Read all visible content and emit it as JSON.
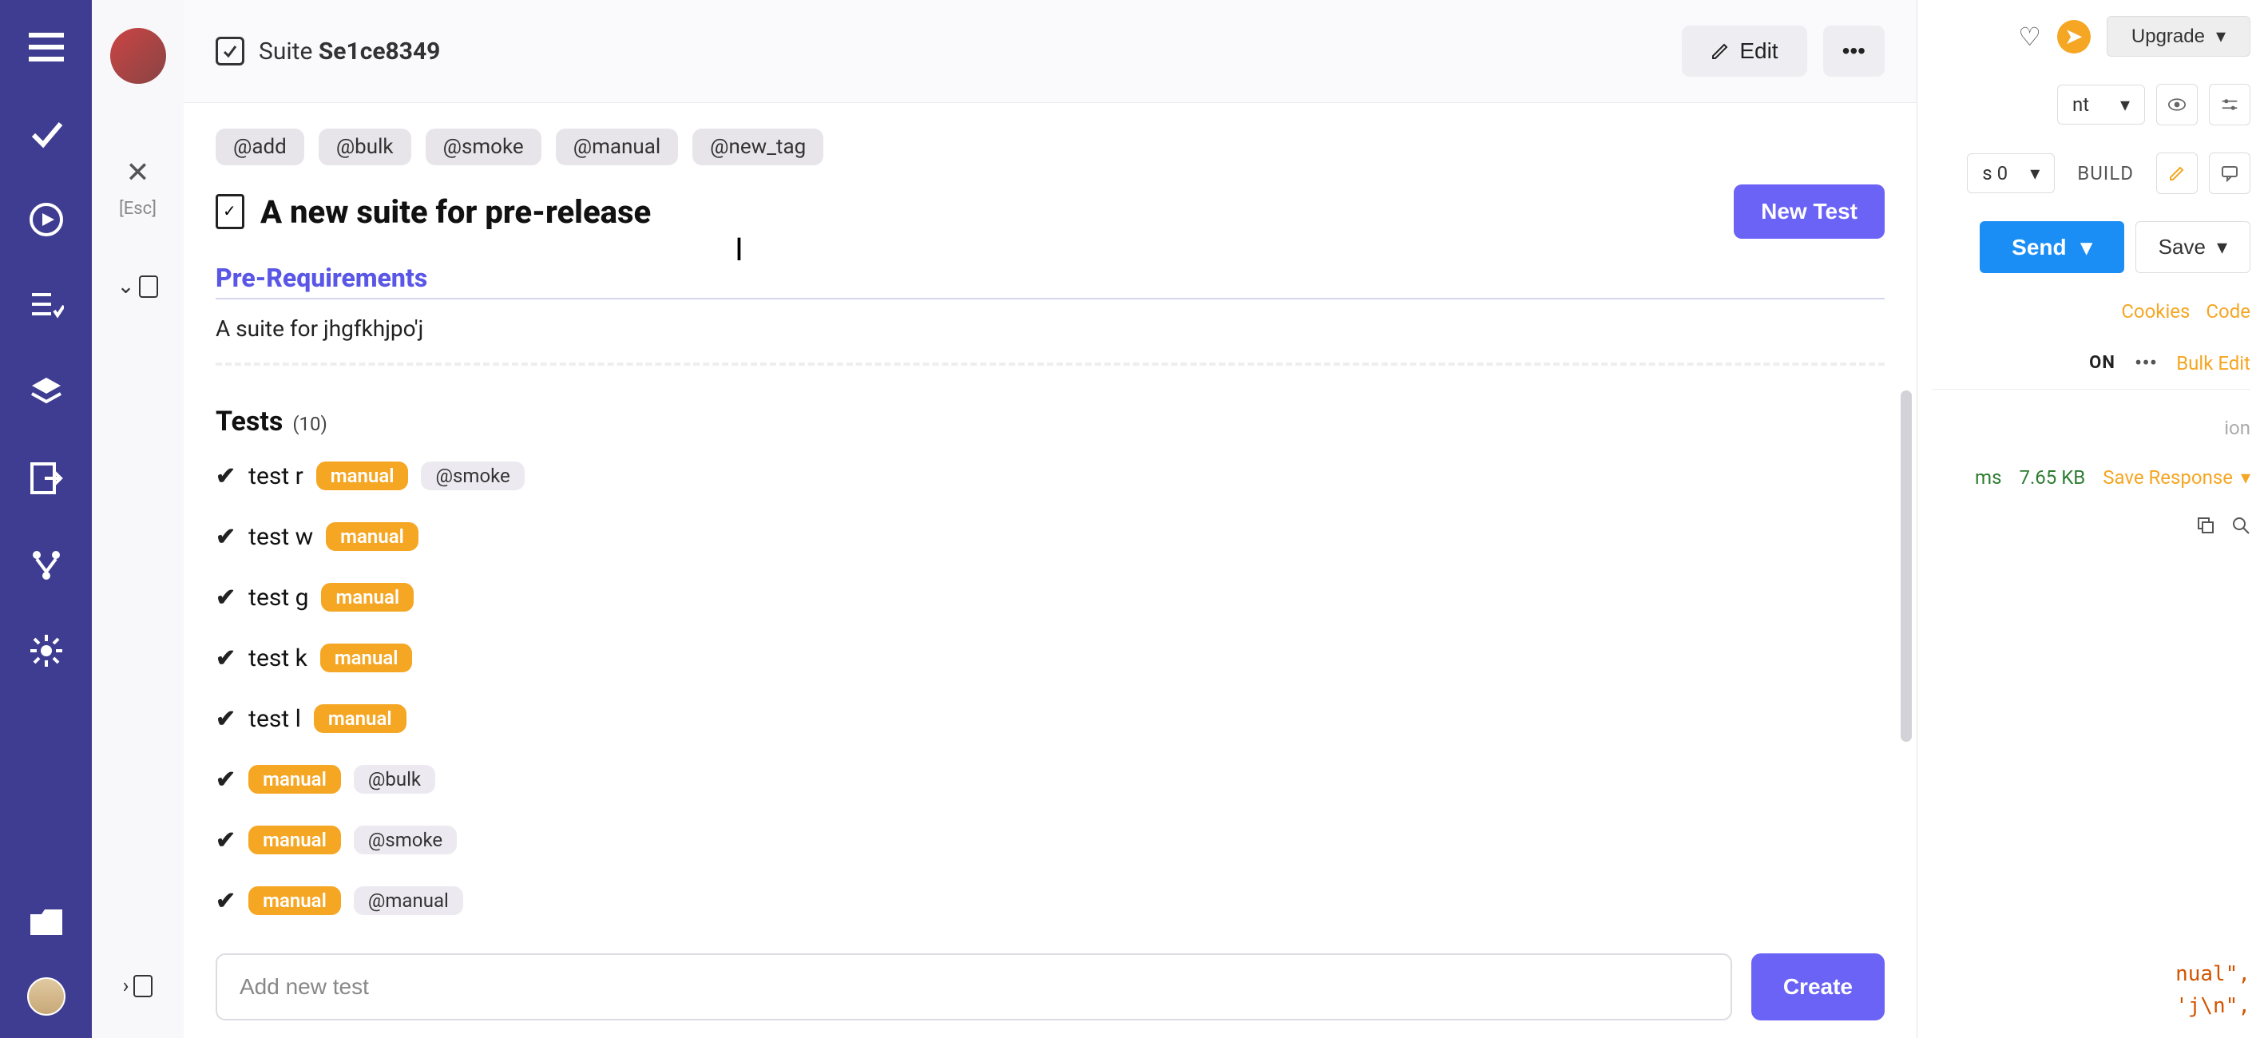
{
  "sidebar": {
    "esc_label": "[Esc]"
  },
  "header": {
    "prefix": "Suite",
    "suite_id": "Se1ce8349",
    "edit_label": "Edit"
  },
  "tags": [
    "@add",
    "@bulk",
    "@smoke",
    "@manual",
    "@new_tag"
  ],
  "suite": {
    "title": "A new suite for pre-release",
    "new_test_label": "New Test",
    "prereq_label": "Pre-Requirements",
    "prereq_text": "A suite for jhgfkhjpo'j"
  },
  "tests": {
    "label": "Tests",
    "count_display": "(10)",
    "items": [
      {
        "name": "test r",
        "manual": true,
        "extra_tag": "@smoke"
      },
      {
        "name": "test w",
        "manual": true,
        "extra_tag": ""
      },
      {
        "name": "test g",
        "manual": true,
        "extra_tag": ""
      },
      {
        "name": "test k",
        "manual": true,
        "extra_tag": ""
      },
      {
        "name": "test l",
        "manual": true,
        "extra_tag": ""
      },
      {
        "name": "",
        "manual": true,
        "extra_tag": "@bulk"
      },
      {
        "name": "",
        "manual": true,
        "extra_tag": "@smoke"
      },
      {
        "name": "",
        "manual": true,
        "extra_tag": "@manual"
      }
    ],
    "manual_pill": "manual",
    "add_placeholder": "Add new test",
    "create_label": "Create"
  },
  "right_panel": {
    "upgrade_label": "Upgrade",
    "env_suffix": "nt",
    "s_num": "s 0",
    "build_label": "BUILD",
    "send_label": "Send",
    "save_label": "Save",
    "cookies_label": "Cookies",
    "code_label": "Code",
    "on_label": "ON",
    "bulk_label": "Bulk Edit",
    "ion_label": "ion",
    "ms_label": "ms",
    "kb_label": "7.65 KB",
    "save_response": "Save Response",
    "code_lines": [
      "nual\",",
      "'j\\n\","
    ]
  }
}
